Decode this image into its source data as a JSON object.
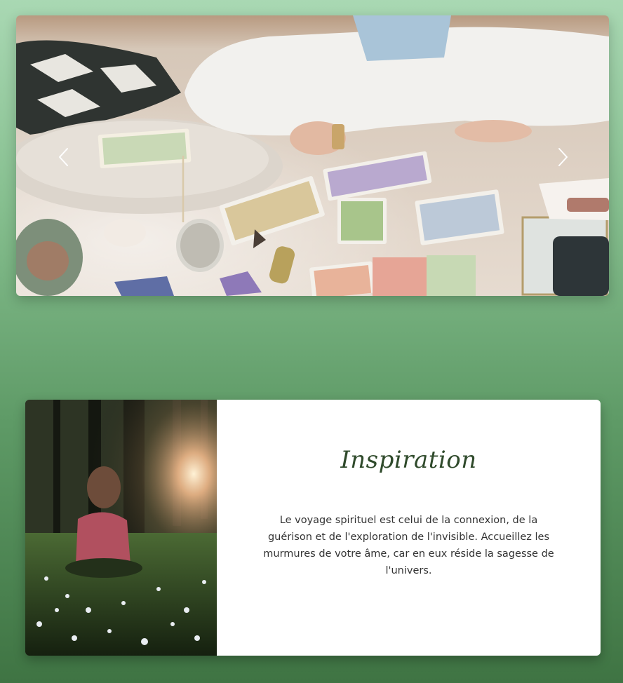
{
  "carousel": {
    "image_icon": "tarot-cards-crystals-photo",
    "prev_icon": "chevron-left-icon",
    "next_icon": "chevron-right-icon"
  },
  "inspiration": {
    "image_icon": "child-sitting-in-meadow-photo",
    "title": "Inspiration",
    "text": "Le voyage spirituel est celui de la connexion, de la guérison et de l'exploration de l'invisible. Accueillez les murmures de votre âme, car en eux réside la sagesse de l'univers."
  },
  "colors": {
    "background_top": "#a9d8b3",
    "background_bottom": "#3f7443",
    "title": "#2f4a2b",
    "body_text": "#333333",
    "card_bg": "#ffffff"
  }
}
